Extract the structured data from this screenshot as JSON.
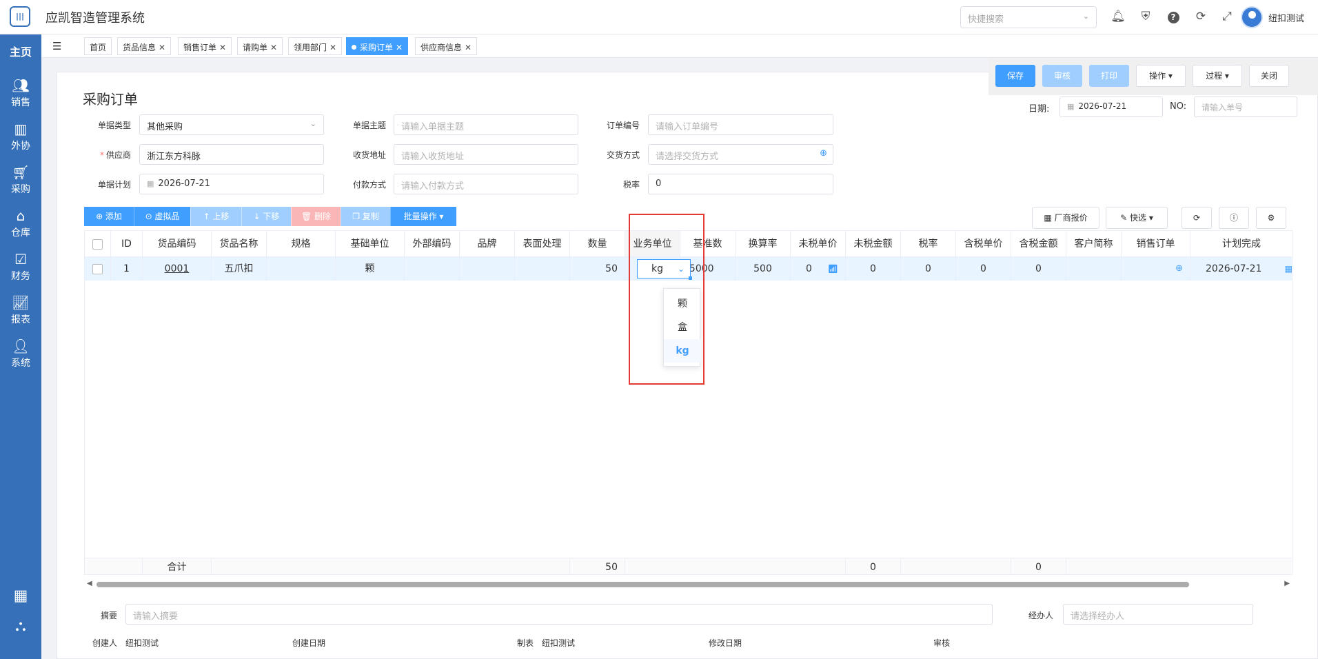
{
  "app": {
    "title": "应凯智造管理系统",
    "logo_text": "|||",
    "quick_search_placeholder": "快捷搜索",
    "user_name": "纽扣测试"
  },
  "icons": {
    "bell": "bell-icon",
    "shield": "shield-icon",
    "help": "help-icon",
    "refresh": "refresh-icon",
    "fullscreen": "fullscreen-icon"
  },
  "sidebar": {
    "home": "主页",
    "items": [
      {
        "label": "销售",
        "icon": "users-icon"
      },
      {
        "label": "外协",
        "icon": "factory-icon"
      },
      {
        "label": "采购",
        "icon": "cart-icon"
      },
      {
        "label": "仓库",
        "icon": "warehouse-icon"
      },
      {
        "label": "财务",
        "icon": "finance-icon"
      },
      {
        "label": "报表",
        "icon": "chart-icon"
      },
      {
        "label": "系统",
        "icon": "user-icon"
      }
    ]
  },
  "tabs": [
    {
      "label": "首页",
      "closable": false
    },
    {
      "label": "货品信息",
      "closable": true
    },
    {
      "label": "销售订单",
      "closable": true
    },
    {
      "label": "请购单",
      "closable": true
    },
    {
      "label": "领用部门",
      "closable": true
    },
    {
      "label": "采购订单",
      "closable": true,
      "active": true
    },
    {
      "label": "供应商信息",
      "closable": true
    }
  ],
  "page": {
    "title": "采购订单"
  },
  "actions": {
    "save": "保存",
    "review": "审核",
    "print": "打印",
    "operate": "操作",
    "process": "过程",
    "close": "关闭"
  },
  "header": {
    "date_label": "日期:",
    "date_value": "2026-07-21",
    "no_label": "NO:",
    "no_placeholder": "请输入单号"
  },
  "form": {
    "doc_type_label": "单据类型",
    "doc_type_value": "其他采购",
    "subject_label": "单据主题",
    "subject_placeholder": "请输入单据主题",
    "order_no_label": "订单编号",
    "order_no_placeholder": "请输入订单编号",
    "supplier_label": "供应商",
    "supplier_value": "浙江东方科脉",
    "address_label": "收货地址",
    "address_placeholder": "请输入收货地址",
    "delivery_label": "交货方式",
    "delivery_placeholder": "请选择交货方式",
    "plan_label": "单据计划",
    "plan_value": "2026-07-21",
    "payment_label": "付款方式",
    "payment_placeholder": "请输入付款方式",
    "tax_label": "税率",
    "tax_value": "0"
  },
  "toolbar": {
    "add": "⊕ 添加",
    "virtual": "⊙ 虚拟品",
    "up": "↑ 上移",
    "down": "↓ 下移",
    "delete": "删除",
    "copy": "复制",
    "batch": "批量操作",
    "vendor_price": "厂商报价",
    "quick_select": "快选"
  },
  "grid": {
    "columns": [
      "ID",
      "货品编码",
      "货品名称",
      "规格",
      "基础单位",
      "外部编码",
      "品牌",
      "表面处理",
      "数量",
      "业务单位",
      "基准数",
      "换算率",
      "未税单价",
      "未税金额",
      "税率",
      "含税单价",
      "含税金额",
      "客户简称",
      "销售订单",
      "计划完成"
    ],
    "rows": [
      {
        "id": "1",
        "code": "0001",
        "name": "五爪扣",
        "spec": "",
        "base_unit": "颗",
        "ext_code": "",
        "brand": "",
        "surface": "",
        "qty": "50",
        "biz_unit": "kg",
        "base_qty": "25000",
        "rate": "500",
        "price_ex": "0",
        "amount_ex": "0",
        "tax": "0",
        "price_in": "0",
        "amount_in": "0",
        "customer": "",
        "sales_order": "",
        "plan_done": "2026-07-21"
      }
    ],
    "footer": {
      "label": "合计",
      "qty": "50",
      "amount_ex": "0",
      "amount_in": "0"
    }
  },
  "unit_dropdown": {
    "current": "kg",
    "options": [
      "颗",
      "盒",
      "kg"
    ],
    "selected": "kg"
  },
  "bottom": {
    "summary_label": "摘要",
    "summary_placeholder": "请输入摘要",
    "handler_label": "经办人",
    "handler_placeholder": "请选择经办人",
    "creator_label": "创建人",
    "creator_value": "纽扣测试",
    "created_label": "创建日期",
    "maker_label": "制表",
    "maker_value": "纽扣测试",
    "modified_label": "修改日期",
    "audit_label": "审核"
  }
}
